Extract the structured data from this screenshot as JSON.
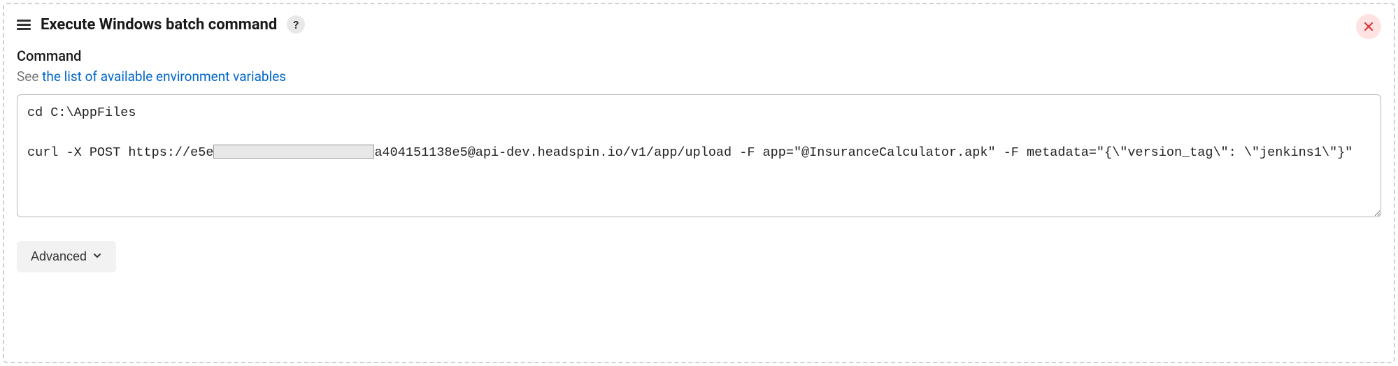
{
  "step": {
    "title": "Execute Windows batch command",
    "help_symbol": "?"
  },
  "field": {
    "label": "Command",
    "help_prefix": "See ",
    "help_link_text": "the list of available environment variables"
  },
  "command": {
    "line1": "cd C:\\AppFiles",
    "line2_pre": "curl -X POST https://e5e",
    "line2_post": "a404151138e5@api-dev.headspin.io/v1/app/upload -F app=\"@InsuranceCalculator.apk\" -F metadata=\"{\\\"version_tag\\\": \\\"jenkins1\\\"}\""
  },
  "buttons": {
    "advanced_label": "Advanced"
  }
}
